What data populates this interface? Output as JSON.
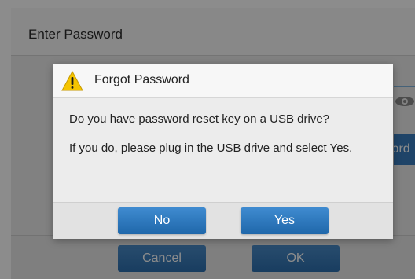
{
  "base_dialog": {
    "title": "Enter Password",
    "field_button_partial": "word",
    "cancel_label": "Cancel",
    "ok_label": "OK"
  },
  "dialog": {
    "icon": "warning-icon",
    "title": "Forgot Password",
    "message_line1": "Do you have password reset key on a USB drive?",
    "message_line2": "If you do, please plug in the USB drive and select Yes.",
    "no_label": "No",
    "yes_label": "Yes"
  },
  "colors": {
    "button_blue": "#2d74b8",
    "warning_yellow": "#f5c400"
  }
}
